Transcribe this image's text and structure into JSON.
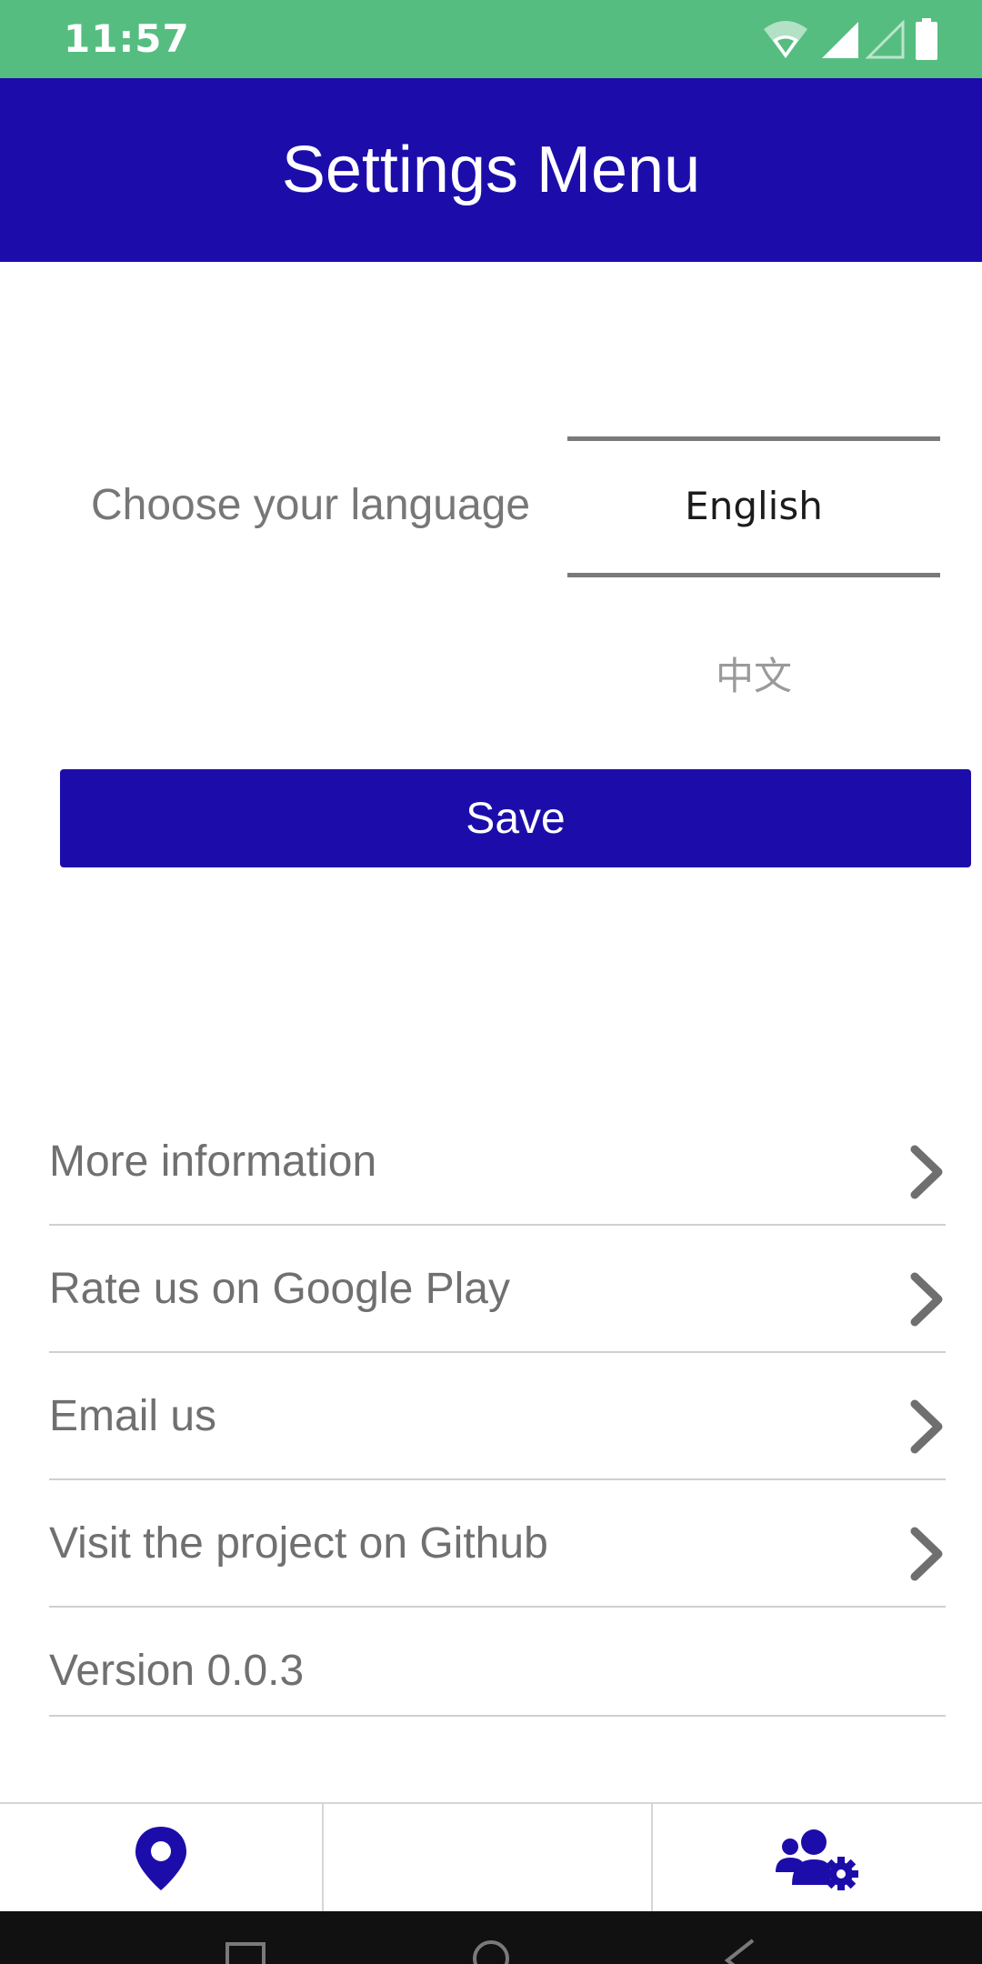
{
  "status_bar": {
    "time": "11:57",
    "icons": [
      "wifi-icon",
      "signal-icon",
      "signal-empty-icon",
      "battery-icon"
    ]
  },
  "header": {
    "title": "Settings Menu"
  },
  "language": {
    "label": "Choose your language",
    "options": [
      "English",
      "中文"
    ],
    "selected": "English"
  },
  "save_button": {
    "label": "Save"
  },
  "menu": {
    "items": [
      {
        "label": "More information"
      },
      {
        "label": "Rate us on Google Play"
      },
      {
        "label": "Email us"
      },
      {
        "label": "Visit the project on Github"
      }
    ],
    "version": "Version 0.0.3"
  },
  "bottom_nav": {
    "icons": [
      "map-pin-icon",
      "users-settings-icon"
    ]
  },
  "colors": {
    "status_bar": "#56bd80",
    "primary": "#1c0dab",
    "text_gray": "#707070",
    "divider": "#cfcfcf"
  }
}
